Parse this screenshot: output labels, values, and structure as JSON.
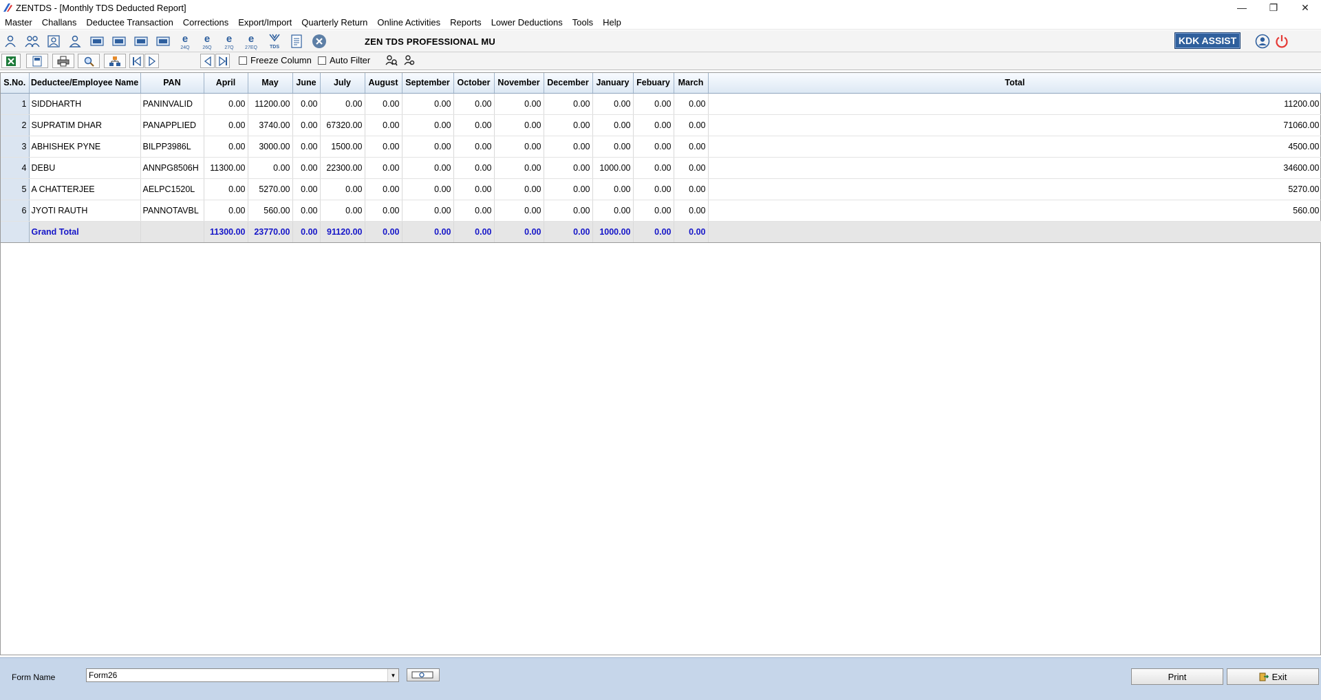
{
  "window": {
    "title": "ZENTDS - [Monthly TDS Deducted Report]",
    "controls": [
      "minimize-icon",
      "restore-icon",
      "close-icon"
    ]
  },
  "menu": [
    "Master",
    "Challans",
    "Deductee Transaction",
    "Corrections",
    "Export/Import",
    "Quarterly Return",
    "Online Activities",
    "Reports",
    "Lower Deductions",
    "Tools",
    "Help"
  ],
  "toolbar": {
    "app_title": "ZEN TDS PROFESSIONAL MU",
    "kdk_label": "KDK ASSIST",
    "icons": [
      "deductor-icon",
      "deductor-group-icon",
      "deductee-icon",
      "employee-icon",
      "form-24q-icon",
      "form-26q-icon",
      "form-27q-icon",
      "form-27eq-icon",
      "e-24q-icon",
      "e-26q-icon",
      "e-27q-icon",
      "e-27eq-icon",
      "tds-icon",
      "report-icon",
      "close-module-icon"
    ],
    "labels": {
      "e1": "24Q",
      "e2": "26Q",
      "e3": "27Q",
      "e4": "27EQ",
      "tds": "TDS"
    }
  },
  "report_toolbar": {
    "freeze_column": "Freeze Column",
    "auto_filter": "Auto Filter",
    "freeze_checked": false,
    "auto_filter_checked": false
  },
  "grid": {
    "columns": [
      "S.No.",
      "Deductee/Employee Name",
      "PAN",
      "April",
      "May",
      "June",
      "July",
      "August",
      "September",
      "October",
      "November",
      "December",
      "January",
      "Febuary",
      "March",
      "Total"
    ],
    "rows": [
      {
        "sno": "1",
        "name": "SIDDHARTH",
        "pan": "PANINVALID",
        "months": [
          "0.00",
          "11200.00",
          "0.00",
          "0.00",
          "0.00",
          "0.00",
          "0.00",
          "0.00",
          "0.00",
          "0.00",
          "0.00",
          "0.00"
        ],
        "total": "11200.00"
      },
      {
        "sno": "2",
        "name": "SUPRATIM DHAR",
        "pan": "PANAPPLIED",
        "months": [
          "0.00",
          "3740.00",
          "0.00",
          "67320.00",
          "0.00",
          "0.00",
          "0.00",
          "0.00",
          "0.00",
          "0.00",
          "0.00",
          "0.00"
        ],
        "total": "71060.00"
      },
      {
        "sno": "3",
        "name": "ABHISHEK PYNE",
        "pan": "BILPP3986L",
        "months": [
          "0.00",
          "3000.00",
          "0.00",
          "1500.00",
          "0.00",
          "0.00",
          "0.00",
          "0.00",
          "0.00",
          "0.00",
          "0.00",
          "0.00"
        ],
        "total": "4500.00"
      },
      {
        "sno": "4",
        "name": "DEBU",
        "pan": "ANNPG8506H",
        "months": [
          "11300.00",
          "0.00",
          "0.00",
          "22300.00",
          "0.00",
          "0.00",
          "0.00",
          "0.00",
          "0.00",
          "1000.00",
          "0.00",
          "0.00"
        ],
        "total": "34600.00"
      },
      {
        "sno": "5",
        "name": "A CHATTERJEE",
        "pan": "AELPC1520L",
        "months": [
          "0.00",
          "5270.00",
          "0.00",
          "0.00",
          "0.00",
          "0.00",
          "0.00",
          "0.00",
          "0.00",
          "0.00",
          "0.00",
          "0.00"
        ],
        "total": "5270.00"
      },
      {
        "sno": "6",
        "name": "JYOTI RAUTH",
        "pan": "PANNOTAVBL",
        "months": [
          "0.00",
          "560.00",
          "0.00",
          "0.00",
          "0.00",
          "0.00",
          "0.00",
          "0.00",
          "0.00",
          "0.00",
          "0.00",
          "0.00"
        ],
        "total": "560.00"
      }
    ],
    "grand_total": {
      "label": "Grand Total",
      "months": [
        "11300.00",
        "23770.00",
        "0.00",
        "91120.00",
        "0.00",
        "0.00",
        "0.00",
        "0.00",
        "0.00",
        "1000.00",
        "0.00",
        "0.00"
      ],
      "total": ""
    }
  },
  "footer": {
    "form_name_label": "Form Name",
    "form_name_value": "Form26",
    "print_label": "Print",
    "exit_label": "Exit"
  },
  "colors": {
    "grand_total_text": "#1515c8",
    "kdk_bg": "#2f5f9c",
    "footer_bg": "#c6d6ea",
    "power": "#e53935"
  }
}
